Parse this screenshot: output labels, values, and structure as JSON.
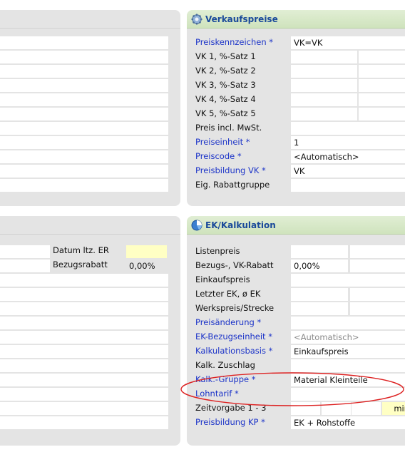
{
  "verkaufspreise": {
    "title": "Verkaufspreise",
    "icon": "gear-icon",
    "rows": [
      {
        "label": "Preiskennzeichen *",
        "required": true,
        "value": "VK=VK"
      },
      {
        "label": "VK 1, %-Satz 1",
        "required": false,
        "value": ""
      },
      {
        "label": "VK 2, %-Satz 2",
        "required": false,
        "value": ""
      },
      {
        "label": "VK 3, %-Satz 3",
        "required": false,
        "value": ""
      },
      {
        "label": "VK 4, %-Satz 4",
        "required": false,
        "value": ""
      },
      {
        "label": "VK 5, %-Satz 5",
        "required": false,
        "value": ""
      },
      {
        "label": "Preis incl. MwSt.",
        "required": false,
        "value": ""
      },
      {
        "label": "Preiseinheit *",
        "required": true,
        "value": "1"
      },
      {
        "label": "Preiscode *",
        "required": true,
        "value": "<Automatisch>"
      },
      {
        "label": "Preisbildung VK *",
        "required": true,
        "value": "VK"
      },
      {
        "label": "Eig. Rabattgruppe",
        "required": false,
        "value": ""
      }
    ]
  },
  "ek_kalkulation": {
    "title": "EK/Kalkulation",
    "icon": "calculation-icon",
    "rows": [
      {
        "label": "Listenpreis",
        "required": false,
        "value": ""
      },
      {
        "label": "Bezugs-, VK-Rabatt",
        "required": false,
        "value": "0,00%"
      },
      {
        "label": "Einkaufspreis",
        "required": false,
        "value": ""
      },
      {
        "label": "Letzter EK, ø EK",
        "required": false,
        "value": ""
      },
      {
        "label": "Werkspreis/Strecke",
        "required": false,
        "value": ""
      },
      {
        "label": "Preisänderung *",
        "required": true,
        "value": ""
      },
      {
        "label": "EK-Bezugseinheit *",
        "required": true,
        "value": "<Automatisch>"
      },
      {
        "label": "Kalkulationsbasis *",
        "required": true,
        "value": "Einkaufspreis"
      },
      {
        "label": "Kalk. Zuschlag",
        "required": false,
        "value": ""
      },
      {
        "label": "Kalk.-Gruppe *",
        "required": true,
        "value": "Material Kleinteile"
      },
      {
        "label": "Lohntarif *",
        "required": true,
        "value": ""
      },
      {
        "label": "Zeitvorgabe 1 - 3",
        "required": false,
        "value": "",
        "unit": "min"
      },
      {
        "label": "Preisbildung KP *",
        "required": true,
        "value": "EK + Rohstoffe"
      }
    ]
  },
  "left_lower": {
    "datum_label": "Datum ltz. ER",
    "datum_value": "",
    "bezugsrabatt_label": "Bezugsrabatt",
    "bezugsrabatt_value": "0,00%"
  },
  "colors": {
    "header_bg": "#d6e8c6",
    "required_label": "#1b33c8",
    "panel_bg": "#e4e4e4",
    "highlight_ellipse": "#dd2222",
    "date_field": "#ffffc4"
  }
}
